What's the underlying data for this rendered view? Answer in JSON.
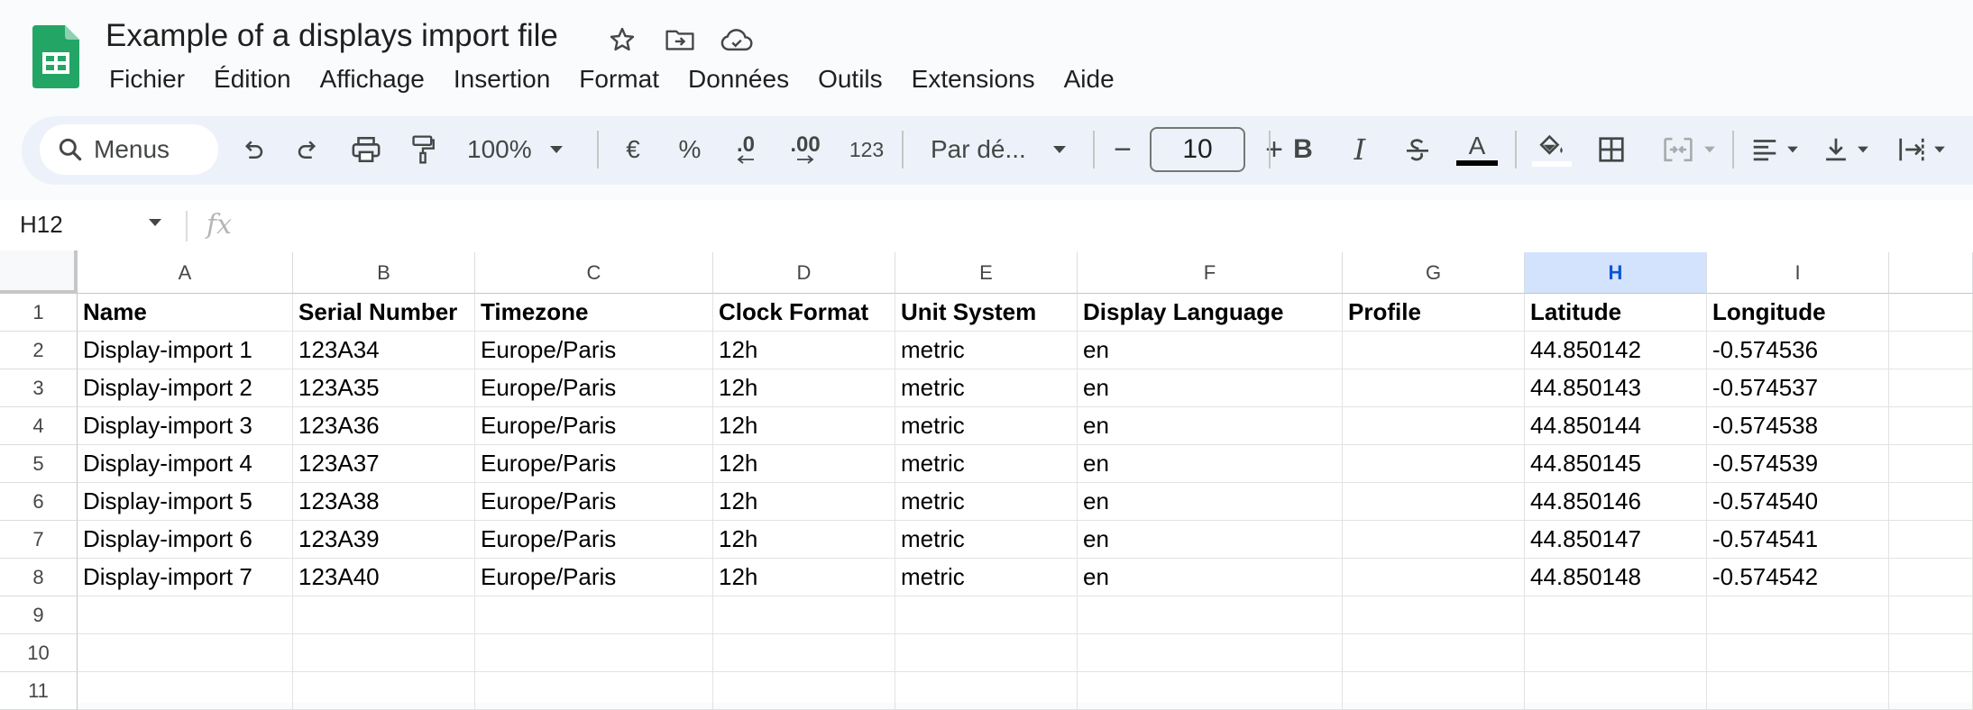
{
  "app": {
    "title": "Example of a displays import file",
    "logo_icon": "google-sheets-logo-icon",
    "title_icons": [
      "star-icon",
      "move-to-folder-icon",
      "cloud-saved-icon"
    ],
    "menus": [
      "Fichier",
      "Édition",
      "Affichage",
      "Insertion",
      "Format",
      "Données",
      "Outils",
      "Extensions",
      "Aide"
    ]
  },
  "toolbar": {
    "search_label": "Menus",
    "zoom": "100%",
    "currency": "€",
    "percent": "%",
    "decrease_decimals": ".0",
    "increase_decimals": ".00",
    "number_format": "123",
    "font_name": "Par dé...",
    "font_size": "10",
    "minus": "−",
    "plus": "+",
    "text_color": "#000000"
  },
  "formula_bar": {
    "name_box": "H12",
    "fx": "fx",
    "value": ""
  },
  "sheet": {
    "selected_column": "H",
    "columns": [
      "A",
      "B",
      "C",
      "D",
      "E",
      "F",
      "G",
      "H",
      "I"
    ],
    "row_numbers": [
      "1",
      "2",
      "3",
      "4",
      "5",
      "6",
      "7",
      "8",
      "9",
      "10",
      "11"
    ],
    "rows": [
      [
        "Name",
        "Serial Number",
        "Timezone",
        "Clock Format",
        "Unit System",
        "Display Language",
        "Profile",
        "Latitude",
        "Longitude"
      ],
      [
        "Display-import 1",
        "123A34",
        "Europe/Paris",
        "12h",
        "metric",
        "en",
        "",
        "44.850142",
        "-0.574536"
      ],
      [
        "Display-import 2",
        "123A35",
        "Europe/Paris",
        "12h",
        "metric",
        "en",
        "",
        "44.850143",
        "-0.574537"
      ],
      [
        "Display-import 3",
        "123A36",
        "Europe/Paris",
        "12h",
        "metric",
        "en",
        "",
        "44.850144",
        "-0.574538"
      ],
      [
        "Display-import 4",
        "123A37",
        "Europe/Paris",
        "12h",
        "metric",
        "en",
        "",
        "44.850145",
        "-0.574539"
      ],
      [
        "Display-import 5",
        "123A38",
        "Europe/Paris",
        "12h",
        "metric",
        "en",
        "",
        "44.850146",
        "-0.574540"
      ],
      [
        "Display-import 6",
        "123A39",
        "Europe/Paris",
        "12h",
        "metric",
        "en",
        "",
        "44.850147",
        "-0.574541"
      ],
      [
        "Display-import 7",
        "123A40",
        "Europe/Paris",
        "12h",
        "metric",
        "en",
        "",
        "44.850148",
        "-0.574542"
      ],
      [
        "",
        "",
        "",
        "",
        "",
        "",
        "",
        "",
        ""
      ],
      [
        "",
        "",
        "",
        "",
        "",
        "",
        "",
        "",
        ""
      ],
      [
        "",
        "",
        "",
        "",
        "",
        "",
        "",
        "",
        ""
      ]
    ]
  }
}
